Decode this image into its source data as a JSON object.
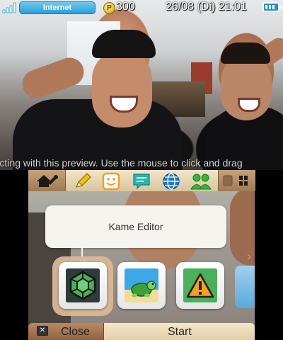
{
  "status_bar": {
    "signal_icon": "wifi-signal-icon",
    "network_label": "Internet",
    "coin_icon": "play-coin-icon",
    "coin_symbol": "P",
    "coins": "300",
    "datetime": "26/08 (Di) 21:01",
    "battery_icon": "battery-icon",
    "battery_level": 1.0
  },
  "preview_hint": "racting with this preview. Use the mouse to click and drag",
  "top_bar": {
    "home_icon": "home-settings-icon",
    "applets": [
      {
        "icon": "notes-pencil-icon",
        "color": "#f2c014"
      },
      {
        "icon": "smiley-face-icon",
        "color": "#f39b26"
      },
      {
        "icon": "speech-bubble-icon",
        "color": "#23b8b2"
      },
      {
        "icon": "globe-icon",
        "color": "#1f78d0"
      },
      {
        "icon": "friends-icon",
        "color": "#37b63a"
      }
    ],
    "view_icon": "grid-view-icon"
  },
  "tooltip": {
    "title": "Kame Editor"
  },
  "tiles": [
    {
      "name": "kame-editor-tile",
      "icon": "turtle-shell-icon",
      "selected": true
    },
    {
      "name": "turtle-beach-tile",
      "icon": "turtle-cartoon-icon",
      "selected": false
    },
    {
      "name": "warning-app-tile",
      "icon": "warning-triangle-icon",
      "selected": false
    }
  ],
  "buttons": {
    "close_icon": "x-button-icon",
    "close_label": "Close",
    "start_label": "Start"
  },
  "colors": {
    "accent_blue": "#2a9fd8",
    "bar_cream": "#f1e5c9",
    "bar_brown": "#9f7b55"
  }
}
